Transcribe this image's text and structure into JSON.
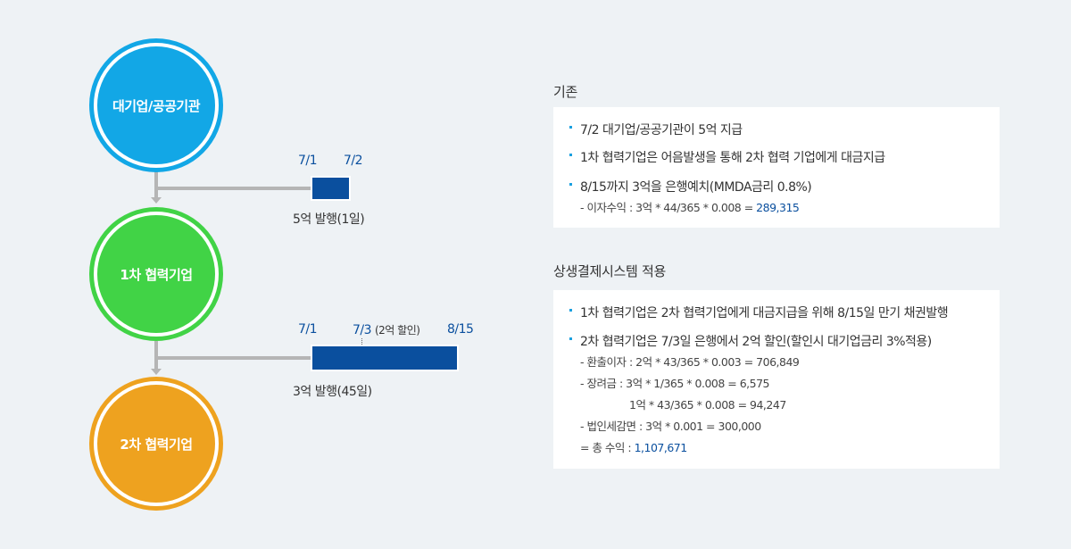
{
  "nodes": {
    "large": "대기업/공공기관",
    "tier1": "1차 협력기업",
    "tier2": "2차 협력기업"
  },
  "colors": {
    "large": "#12a7e6",
    "tier1": "#41d346",
    "tier2": "#eea21f",
    "bar": "#0a4f9e",
    "accent_text": "#0a4f9e"
  },
  "flow1": {
    "date_start": "7/1",
    "date_end": "7/2",
    "caption": "5억 발행(1일)"
  },
  "flow2": {
    "date_start": "7/1",
    "date_mid": "7/3",
    "date_mid_note": "(2억 할인)",
    "date_end": "8/15",
    "caption": "3억 발행(45일)"
  },
  "existing": {
    "title": "기존",
    "items": [
      "7/2 대기업/공공기관이 5억 지급",
      "1차 협력기업은 어음발생을 통해 2차 협력 기업에게 대금지급",
      "8/15까지 3억을 은행예치(MMDA금리 0.8%)"
    ],
    "interest_label": "- 이자수익 : 3억 * 44/365 * 0.008 = ",
    "interest_value": "289,315"
  },
  "system": {
    "title": "상생결제시스템 적용",
    "items": [
      "1차 협력기업은 2차 협력기업에게 대금지급을 위해 8/15일 만기 채권발행",
      "2차 협력기업은 7/3일 은행에서 2억 할인(할인시 대기업금리 3%적용)"
    ],
    "details": [
      "- 환출이자 : 2억 * 43/365 * 0.003 = 706,849",
      "- 장려금 : 3억 * 1/365 * 0.008 = 6,575",
      "1억 * 43/365 * 0.008 = 94,247",
      "- 법인세감면 : 3억 * 0.001 = 300,000"
    ],
    "total_label": "= 총 수익 : ",
    "total_value": "1,107,671"
  }
}
